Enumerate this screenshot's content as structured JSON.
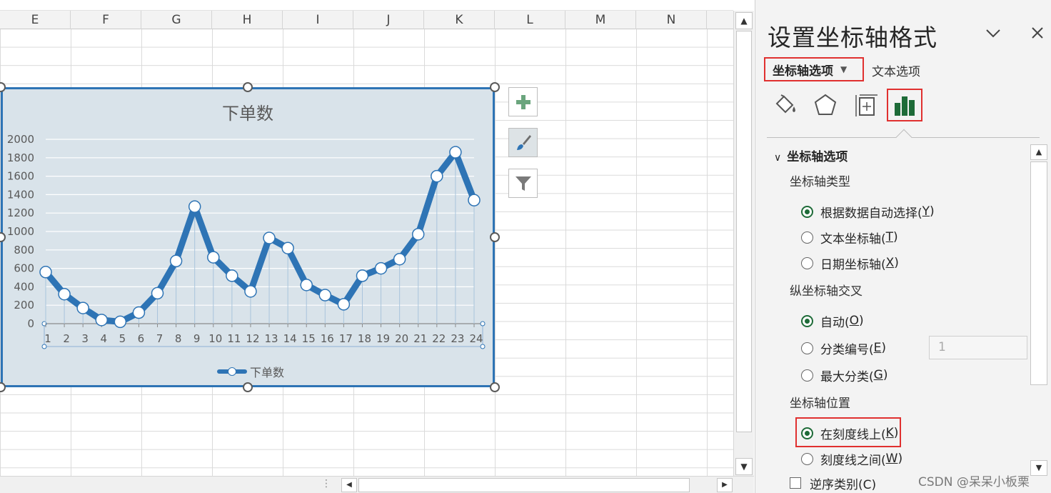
{
  "sheet": {
    "columns": [
      "E",
      "F",
      "G",
      "H",
      "I",
      "J",
      "K",
      "L",
      "M",
      "N"
    ]
  },
  "chart_data": {
    "type": "line",
    "title": "下单数",
    "x": [
      1,
      2,
      3,
      4,
      5,
      6,
      7,
      8,
      9,
      10,
      11,
      12,
      13,
      14,
      15,
      16,
      17,
      18,
      19,
      20,
      21,
      22,
      23,
      24
    ],
    "series": [
      {
        "name": "下单数",
        "values": [
          560,
          320,
          170,
          40,
          20,
          120,
          330,
          680,
          1270,
          720,
          520,
          350,
          930,
          820,
          420,
          310,
          210,
          520,
          600,
          700,
          970,
          1600,
          1860,
          1340
        ]
      }
    ],
    "ylim": [
      0,
      2000
    ],
    "yticks": [
      0,
      200,
      400,
      600,
      800,
      1000,
      1200,
      1400,
      1600,
      1800,
      2000
    ],
    "grid": true,
    "drop_lines": true,
    "legend": "bottom",
    "line_color": "#2e74b5",
    "background": "#d9e3ea"
  },
  "chart_buttons": {
    "add_element_icon": "plus-icon",
    "style_icon": "paintbrush-icon",
    "filter_icon": "funnel-icon"
  },
  "pane": {
    "title": "设置坐标轴格式",
    "collapse_icon": "chevron-down-icon",
    "close_icon": "close-icon",
    "tabs": {
      "axis_options": "坐标轴选项",
      "text_options": "文本选项"
    },
    "icons": [
      "fill-line-icon",
      "effects-pentagon-icon",
      "size-properties-icon",
      "axis-options-bar-icon"
    ],
    "section_title": "坐标轴选项",
    "axis_type": {
      "label": "坐标轴类型",
      "options": [
        {
          "text": "根据数据自动选择(",
          "key": "Y",
          "end": ")",
          "checked": true
        },
        {
          "text": "文本坐标轴(",
          "key": "T",
          "end": ")",
          "checked": false
        },
        {
          "text": "日期坐标轴(",
          "key": "X",
          "end": ")",
          "checked": false
        }
      ]
    },
    "vertical_cross": {
      "label": "纵坐标轴交叉",
      "options": [
        {
          "text": "自动(",
          "key": "O",
          "end": ")",
          "checked": true
        },
        {
          "text": "分类编号(",
          "key": "E",
          "end": ")",
          "checked": false
        },
        {
          "text": "最大分类(",
          "key": "G",
          "end": ")",
          "checked": false
        }
      ],
      "category_number_value": "1"
    },
    "axis_position": {
      "label": "坐标轴位置",
      "options": [
        {
          "text": "在刻度线上(",
          "key": "K",
          "end": ")",
          "checked": true
        },
        {
          "text": "刻度线之间(",
          "key": "W",
          "end": ")",
          "checked": false
        }
      ]
    },
    "reverse_label": "逆序类别(C)",
    "highlight_color": "#e0302f",
    "accent_color": "#1e6b38"
  },
  "watermark": "CSDN @呆呆小板栗"
}
